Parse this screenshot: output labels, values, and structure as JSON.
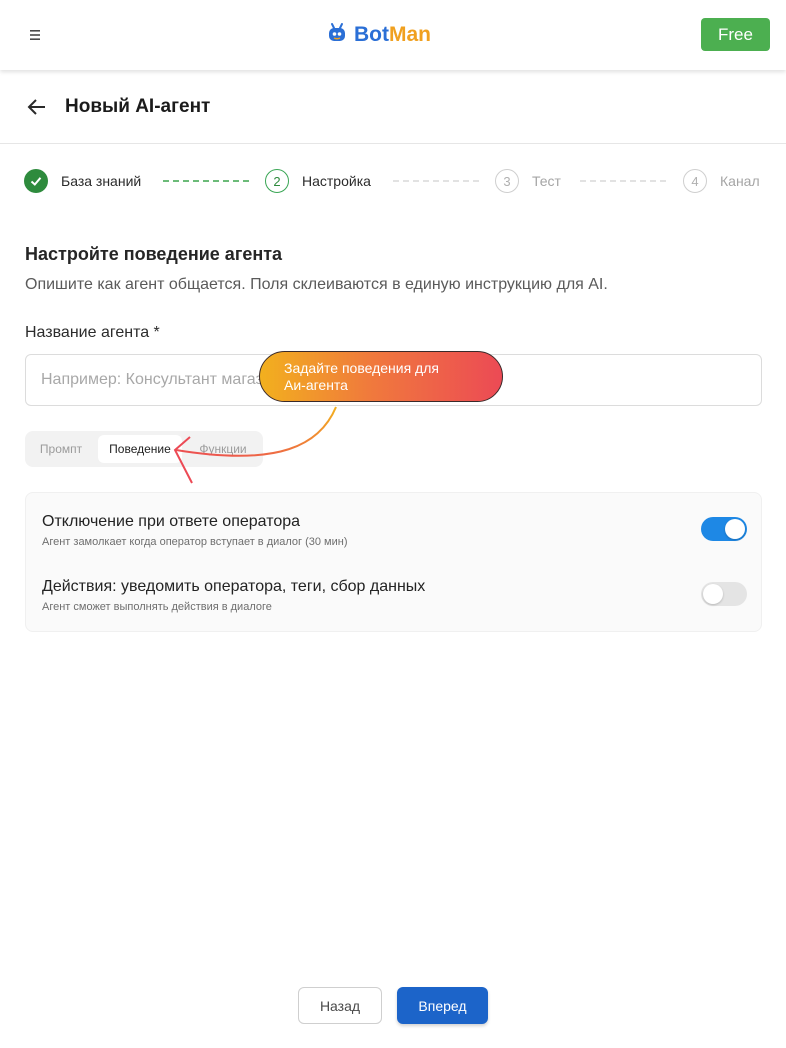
{
  "header": {
    "menu_icon": "hamburger-icon",
    "logo": {
      "part1": "Bot",
      "part2": "Man",
      "icon": "robot-icon"
    },
    "plan_button": "Free",
    "colors": {
      "brand_blue": "#2b6fd6",
      "brand_orange": "#f0a01f",
      "plan_green": "#4caf50"
    }
  },
  "page": {
    "back_icon": "arrow-left-icon",
    "title": "Новый AI-агент"
  },
  "stepper": {
    "steps": [
      {
        "number": "1",
        "label": "База знаний",
        "state": "done"
      },
      {
        "number": "2",
        "label": "Настройка",
        "state": "active"
      },
      {
        "number": "3",
        "label": "Тест",
        "state": "pending"
      },
      {
        "number": "4",
        "label": "Канал",
        "state": "pending"
      }
    ]
  },
  "section": {
    "title": "Настройте поведение агента",
    "description": "Опишите как агент общается. Поля склеиваются в единую инструкцию для AI."
  },
  "agent_name": {
    "label": "Название агента *",
    "value": "",
    "placeholder": "Например: Консультант магазина"
  },
  "tabs": {
    "items": [
      "Промпт",
      "Поведение",
      "Функции"
    ],
    "selected": "Поведение"
  },
  "tooltip": {
    "line1": "Задайте поведения для",
    "line2": "Аи-агента"
  },
  "options": [
    {
      "title": "Отключение при ответе оператора",
      "description": "Агент замолкает когда оператор вступает в диалог (30 мин)",
      "enabled": true
    },
    {
      "title": "Действия: уведомить оператора, теги, сбор данных",
      "description": "Агент сможет выполнять действия в диалоге",
      "enabled": false
    }
  ],
  "footer": {
    "back_label": "Назад",
    "next_label": "Вперед",
    "accent_color": "#1c64c9"
  }
}
